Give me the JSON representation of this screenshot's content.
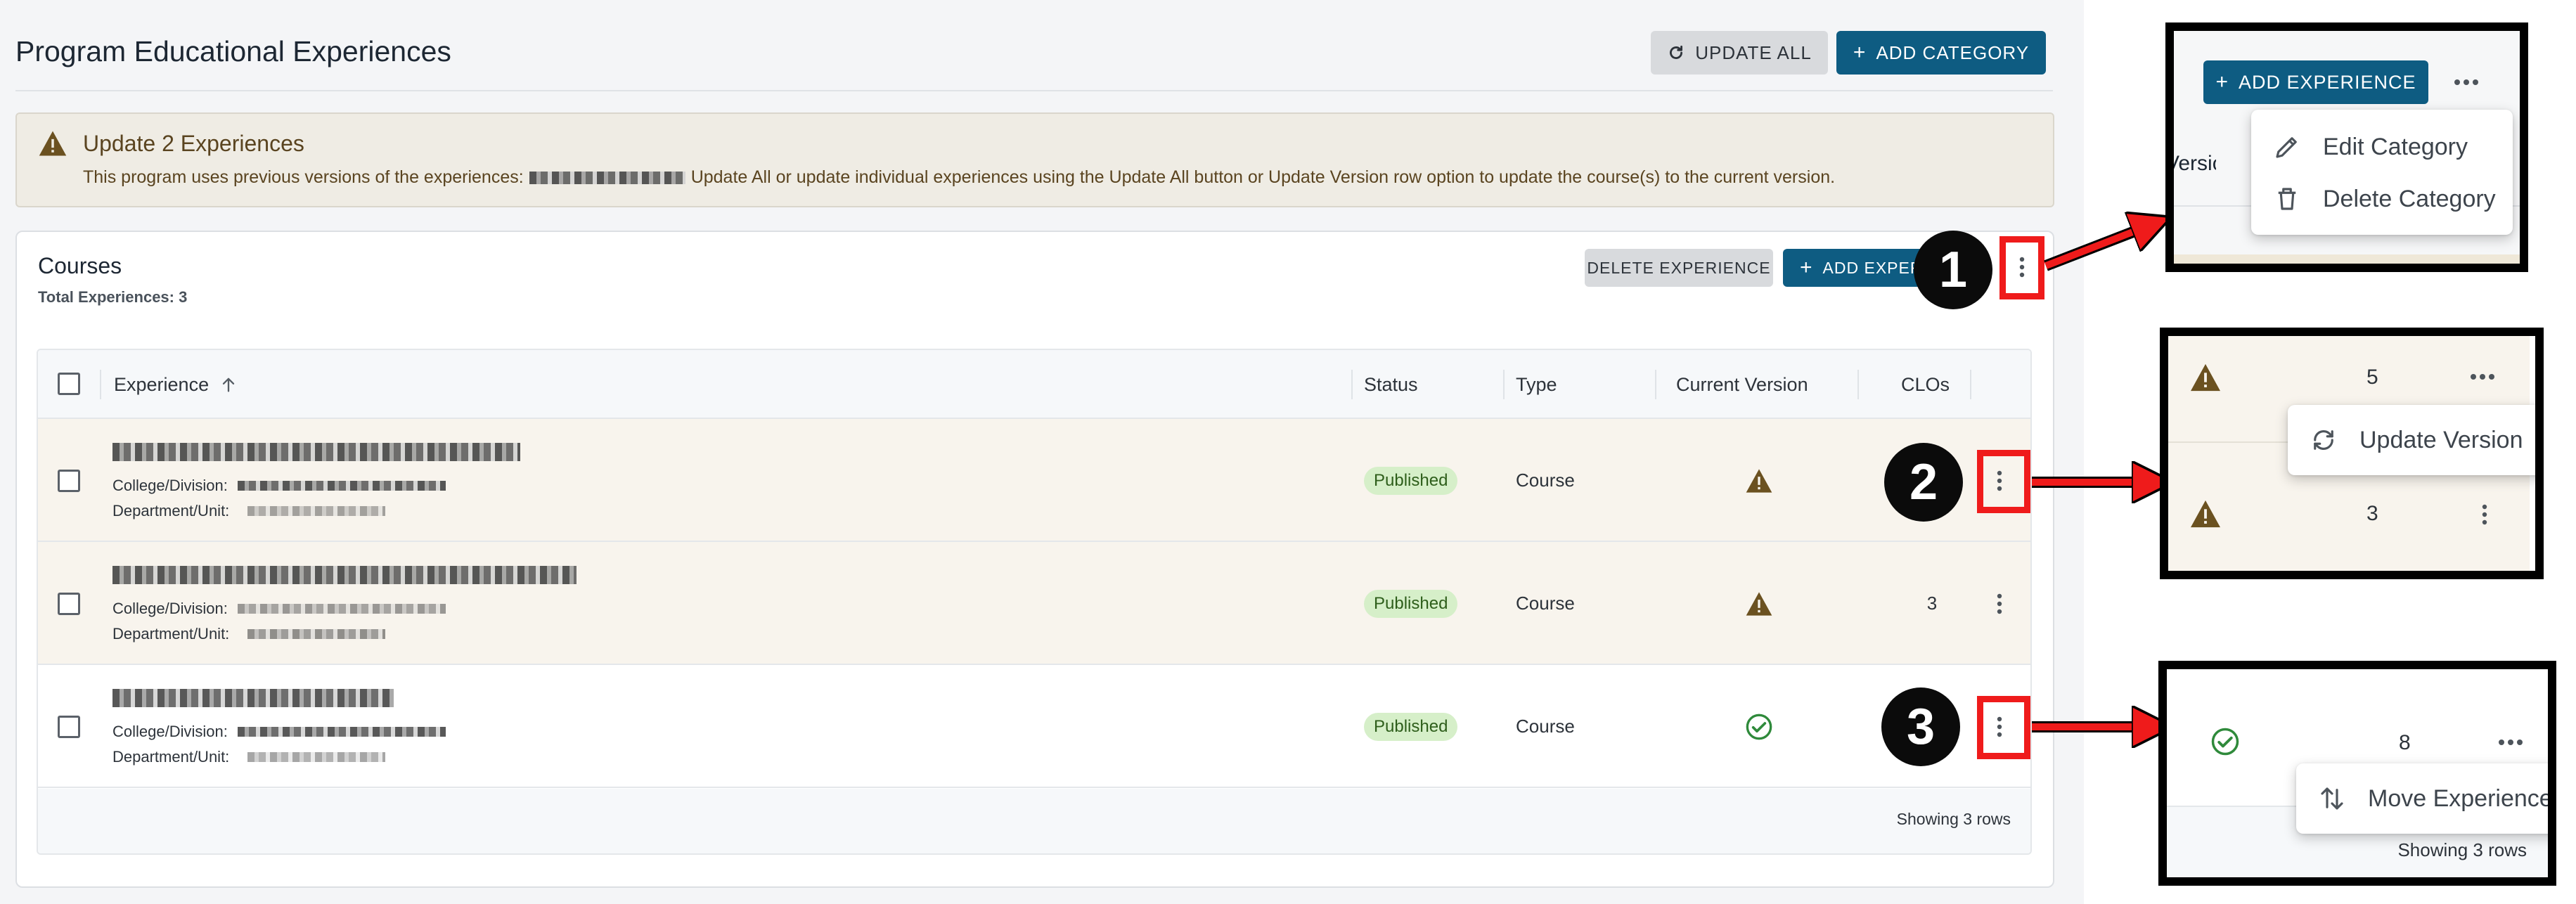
{
  "page": {
    "title": "Program Educational Experiences",
    "update_all_label": "UPDATE ALL",
    "add_category_label": "ADD CATEGORY"
  },
  "banner": {
    "title": "Update 2 Experiences",
    "text_before": "This program uses previous versions of the experiences:",
    "text_after": "Update All or update individual experiences using the Update All button or Update Version row option to update the course(s) to the current version."
  },
  "card": {
    "title": "Courses",
    "subtitle": "Total Experiences: 3",
    "delete_label": "DELETE EXPERIENCE",
    "add_label": "ADD EXPER"
  },
  "table": {
    "columns": {
      "experience": "Experience",
      "status": "Status",
      "type": "Type",
      "current_version": "Current Version",
      "clos": "CLOs"
    },
    "meta_labels": {
      "college": "College/Division:",
      "department": "Department/Unit:"
    },
    "rows": [
      {
        "status": "Published",
        "type": "Course",
        "version_icon": "warning-icon",
        "clos": "",
        "highlight": true
      },
      {
        "status": "Published",
        "type": "Course",
        "version_icon": "warning-icon",
        "clos": "3",
        "highlight": true
      },
      {
        "status": "Published",
        "type": "Course",
        "version_icon": "check-circle-icon",
        "clos": "",
        "highlight": false
      }
    ],
    "footer": "Showing 3 rows"
  },
  "callouts": [
    "1",
    "2",
    "3"
  ],
  "zoom1": {
    "add_label": "ADD EXPERIENCE",
    "partial_header": "Version",
    "menu": [
      "Edit Category",
      "Delete Category"
    ]
  },
  "zoom2": {
    "row_a_clos": "5",
    "row_b_clos": "3",
    "menu": [
      "Update Version"
    ]
  },
  "zoom3": {
    "row_clos": "8",
    "menu": [
      "Move Experience"
    ],
    "footer": "Showing 3 rows"
  },
  "colors": {
    "primary": "#0e5c82",
    "warning_row": "#f8f4ed",
    "published_pill": "#d6efc9",
    "annotation_red": "#ef1b1b"
  }
}
